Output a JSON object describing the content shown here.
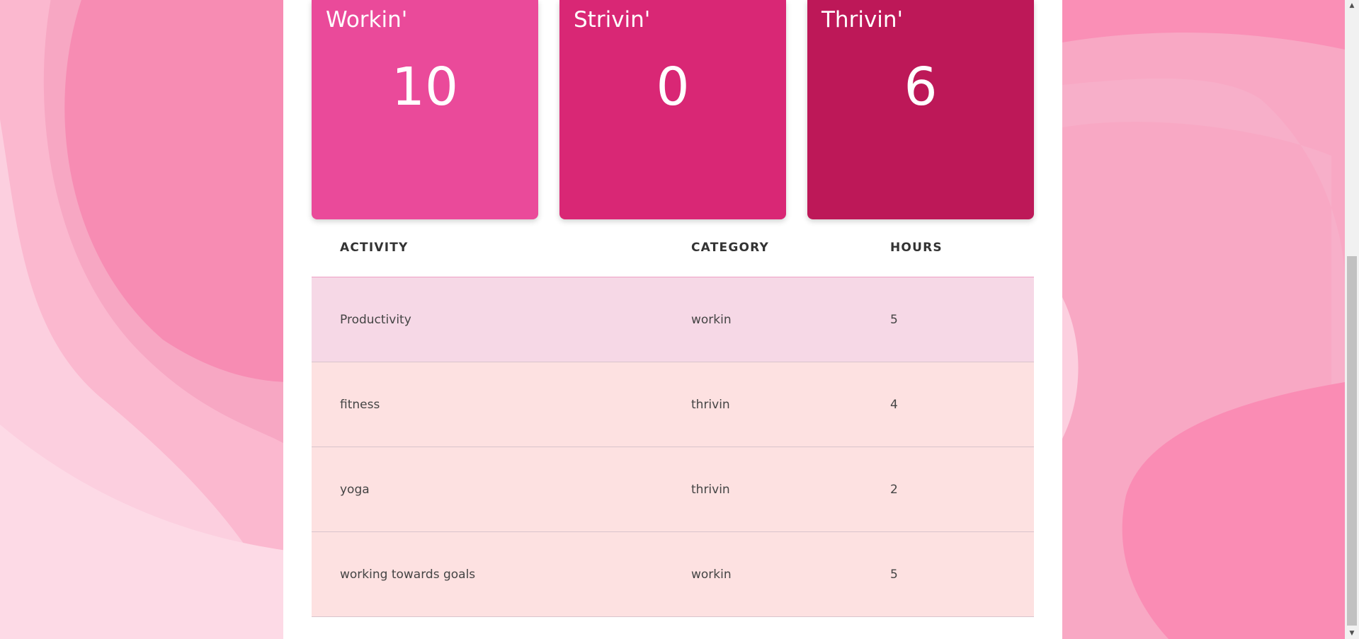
{
  "colors": {
    "workin_card": "#ea4a9a",
    "strivin_card": "#d92775",
    "thrivin_card": "#bd1858",
    "highlight_row": "#f6d8e6",
    "normal_row": "#fde1e1"
  },
  "cards": [
    {
      "title": "Workin'",
      "value": "10"
    },
    {
      "title": "Strivin'",
      "value": "0"
    },
    {
      "title": "Thrivin'",
      "value": "6"
    }
  ],
  "table": {
    "headers": [
      "ACTIVITY",
      "CATEGORY",
      "HOURS"
    ],
    "rows": [
      {
        "activity": "Productivity",
        "category": "workin",
        "hours": "5",
        "highlighted": true
      },
      {
        "activity": "fitness",
        "category": "thrivin",
        "hours": "4",
        "highlighted": false
      },
      {
        "activity": "yoga",
        "category": "thrivin",
        "hours": "2",
        "highlighted": false
      },
      {
        "activity": "working towards goals",
        "category": "workin",
        "hours": "5",
        "highlighted": false
      }
    ]
  },
  "scrollbar": {
    "up_icon": "scroll-up-arrow-icon",
    "down_icon": "scroll-down-arrow-icon"
  }
}
